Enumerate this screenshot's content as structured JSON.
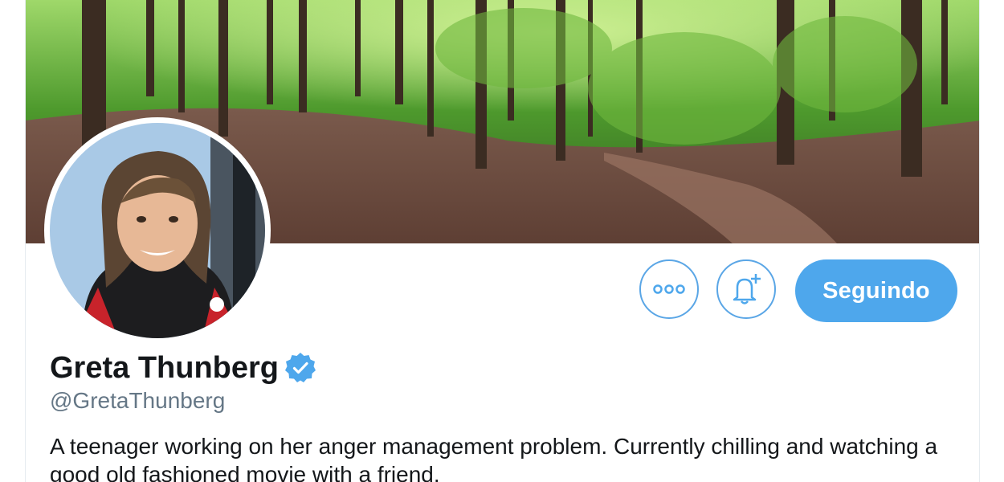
{
  "profile": {
    "display_name": "Greta Thunberg",
    "handle": "@GretaThunberg",
    "bio": "A teenager working on her anger management problem. Currently chilling and watching a good old fashioned movie with a friend.",
    "verified": true
  },
  "actions": {
    "more_icon": "more-options-icon",
    "notify_icon": "bell-plus-icon",
    "follow_label": "Seguindo"
  },
  "colors": {
    "accent": "#4ea7ec",
    "accent_border": "#5aa6e6",
    "text_primary": "#14171a",
    "text_secondary": "#657786"
  }
}
